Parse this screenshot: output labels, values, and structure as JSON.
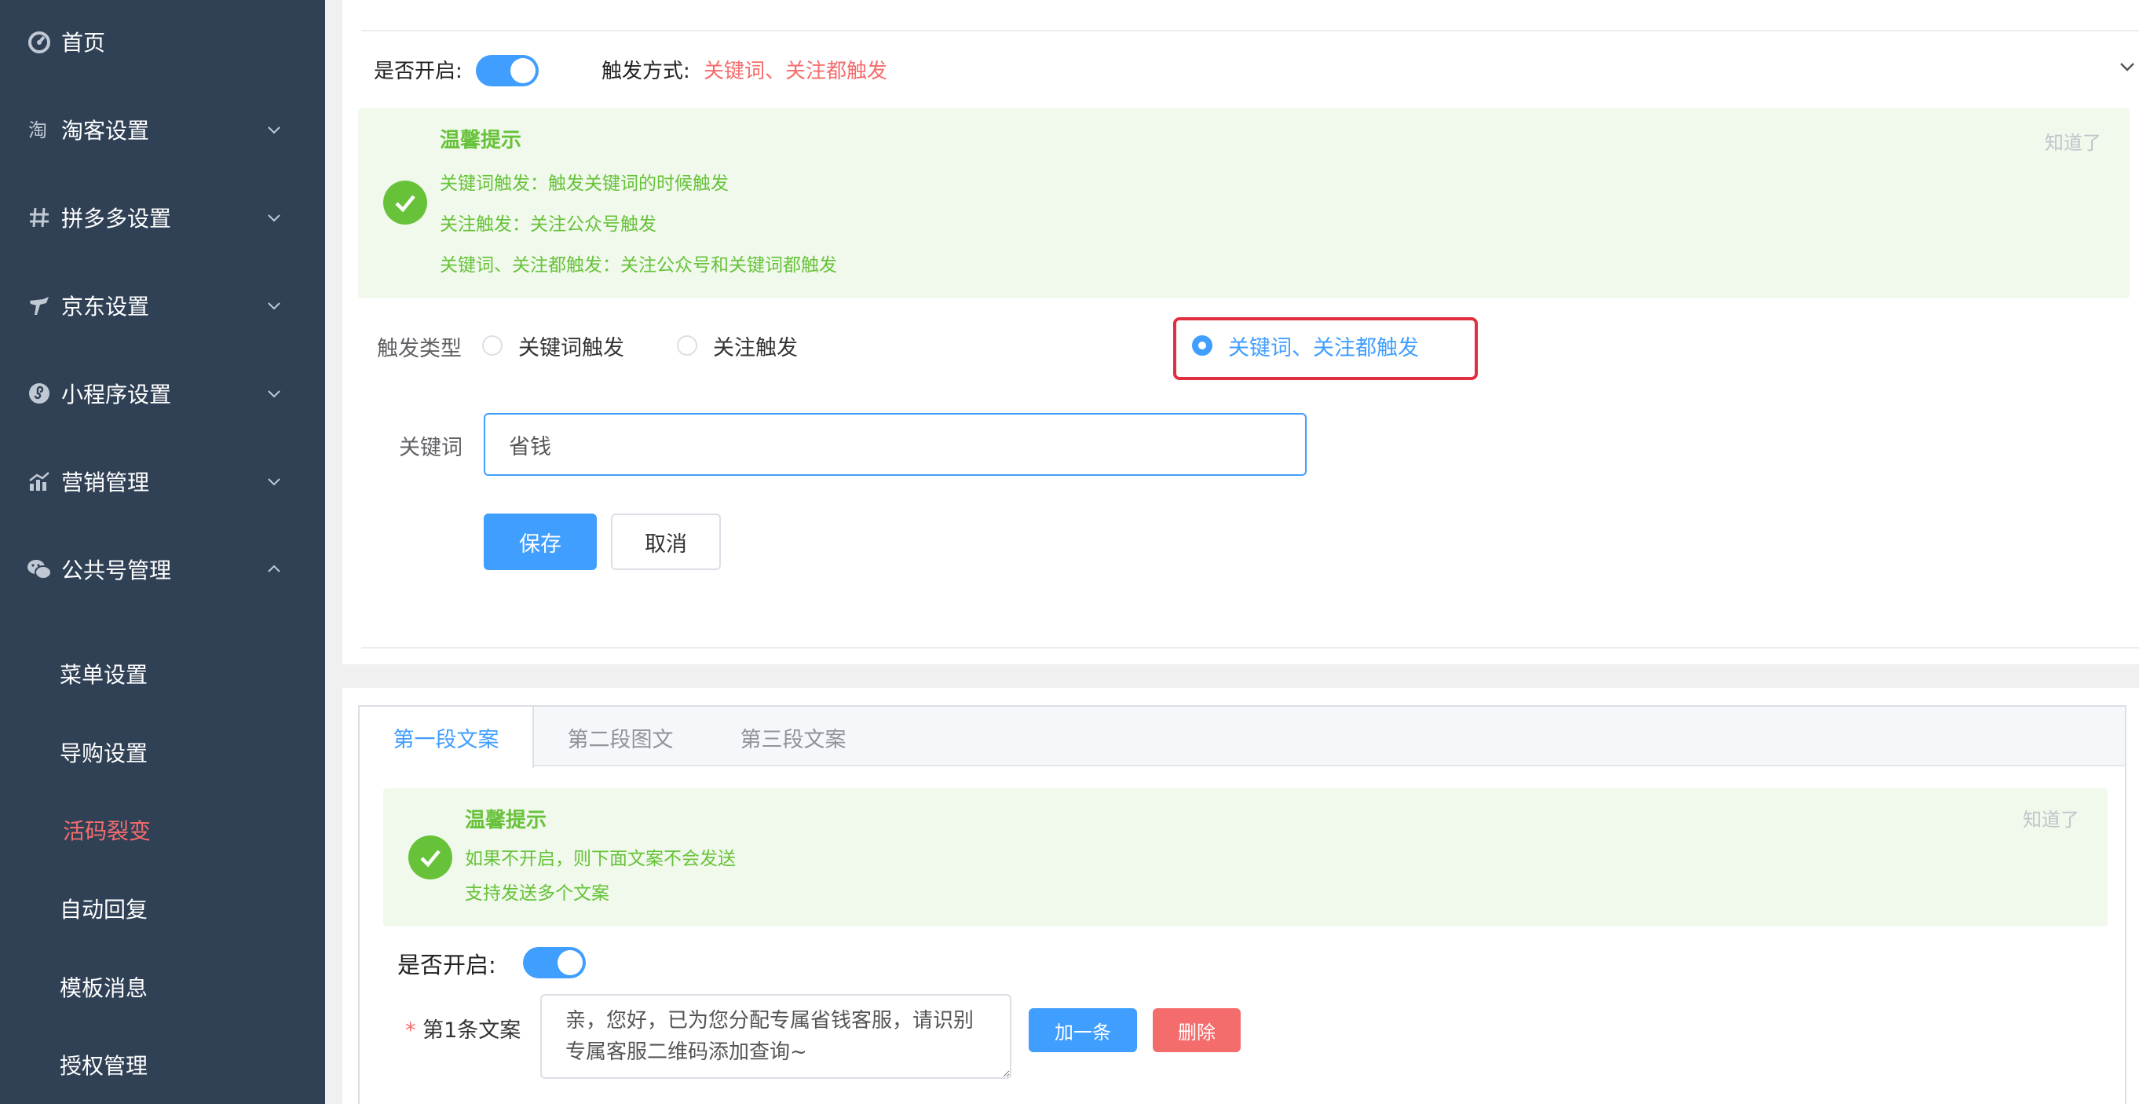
{
  "sidebar": {
    "menu": [
      {
        "label": "首页",
        "icon": "dashboard-icon"
      },
      {
        "label": "淘客设置",
        "icon": "taobao-icon"
      },
      {
        "label": "拼多多设置",
        "icon": "hash-icon"
      },
      {
        "label": "京东设置",
        "icon": "jd-dog-icon"
      },
      {
        "label": "小程序设置",
        "icon": "miniprogram-icon"
      },
      {
        "label": "营销管理",
        "icon": "chart-icon"
      },
      {
        "label": "公共号管理",
        "icon": "wechat-icon"
      }
    ],
    "submenu": [
      {
        "label": "菜单设置"
      },
      {
        "label": "导购设置"
      },
      {
        "label": "活码裂变"
      },
      {
        "label": "自动回复"
      },
      {
        "label": "模板消息"
      },
      {
        "label": "授权管理"
      }
    ],
    "active_sub": "活码裂变"
  },
  "panel1": {
    "enabled_label": "是否开启:",
    "trigger_label": "触发方式:",
    "trigger_value": "关键词、关注都触发",
    "alert": {
      "title": "温馨提示",
      "lines": [
        "关键词触发：触发关键词的时候触发",
        "关注触发：关注公众号触发",
        "关键词、关注都触发：关注公众号和关键词都触发"
      ],
      "close": "知道了"
    },
    "trigger_type_label": "触发类型",
    "radios": [
      {
        "label": "关键词触发",
        "checked": false
      },
      {
        "label": "关注触发",
        "checked": false
      },
      {
        "label": "关键词、关注都触发",
        "checked": true
      }
    ],
    "keyword_label": "关键词",
    "keyword_value": "省钱",
    "save_label": "保存",
    "cancel_label": "取消"
  },
  "panel2": {
    "tabs": [
      {
        "label": "第一段文案"
      },
      {
        "label": "第二段图文"
      },
      {
        "label": "第三段文案"
      }
    ],
    "alert": {
      "title": "温馨提示",
      "lines": [
        "如果不开启，则下面文案不会发送",
        "支持发送多个文案"
      ],
      "close": "知道了"
    },
    "enabled_label": "是否开启:",
    "copy_label": "第1条文案",
    "required_mark": "*",
    "copy_value": "亲，您好，已为您分配专属省钱客服，请识别专属客服二维码添加查询~",
    "add_label": "加一条",
    "delete_label": "删除"
  },
  "colors": {
    "sidebar_bg": "#304156",
    "primary": "#409eff",
    "danger": "#f56c6c",
    "success": "#67c23a",
    "alert_bg": "#f0f9eb",
    "highlight": "#e03040"
  }
}
